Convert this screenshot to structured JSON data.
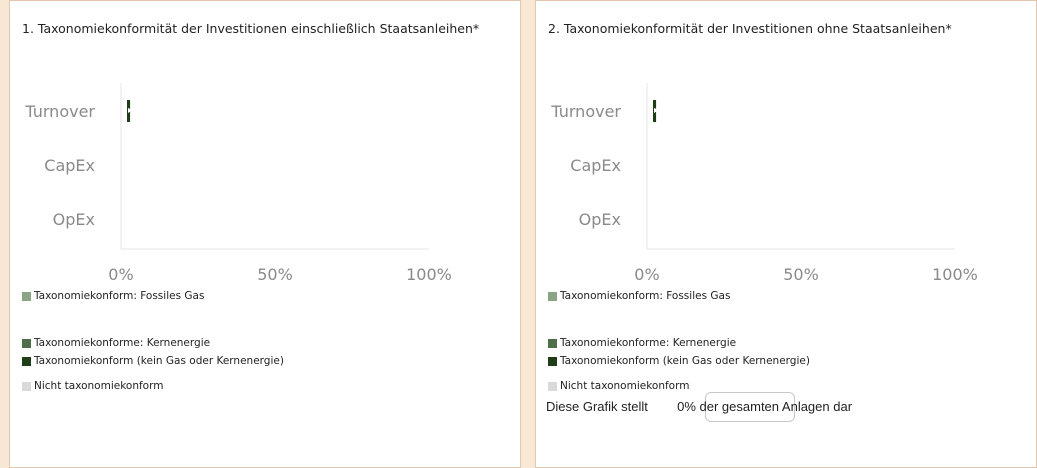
{
  "colors": {
    "fossil_gas": "#8aa585",
    "nuclear": "#4e6e4a",
    "aligned_other": "#1f3d17",
    "not_aligned": "#d9d9d9"
  },
  "panels": [
    {
      "title": "1. Taxonomiekonformität der Investitionen einschließlich Staatsanleihen*",
      "legend": [
        {
          "label": "Taxonomiekonform: Fossiles Gas",
          "color": "#8aa585"
        },
        {
          "label": "Taxonomiekonforme: Kernenergie",
          "color": "#4e6e4a"
        },
        {
          "label": "Taxonomiekonform (kein Gas oder Kernenergie)",
          "color": "#1f3d17"
        },
        {
          "label": "Nicht taxonomiekonform",
          "color": "#d9d9d9"
        }
      ]
    },
    {
      "title": "2. Taxonomiekonformität der Investitionen ohne Staatsanleihen*",
      "legend": [
        {
          "label": "Taxonomiekonform: Fossiles Gas",
          "color": "#8aa585"
        },
        {
          "label": "Taxonomiekonforme: Kernenergie",
          "color": "#4e6e4a"
        },
        {
          "label": "Taxonomiekonform (kein Gas oder Kernenergie)",
          "color": "#1f3d17"
        },
        {
          "label": "Nicht taxonomiekonform",
          "color": "#d9d9d9"
        }
      ],
      "footnote": {
        "prefix": "Diese Grafik stellt",
        "value": "0",
        "suffix": "% der gesamten Anlagen dar"
      }
    }
  ],
  "chart_data": [
    {
      "type": "bar",
      "orientation": "horizontal",
      "stacked": true,
      "title": "1. Taxonomiekonformität der Investitionen einschließlich Staatsanleihen*",
      "categories": [
        "Turnover",
        "CapEx",
        "OpEx"
      ],
      "x_ticks": [
        "0%",
        "50%",
        "100%"
      ],
      "xlim": [
        0,
        100
      ],
      "series": [
        {
          "name": "Taxonomiekonform: Fossiles Gas",
          "values": [
            0,
            0,
            0
          ]
        },
        {
          "name": "Taxonomiekonforme: Kernenergie",
          "values": [
            0,
            0,
            0
          ]
        },
        {
          "name": "Taxonomiekonform (kein Gas oder Kernenergie)",
          "values": [
            1,
            0,
            0
          ]
        },
        {
          "name": "Nicht taxonomiekonform",
          "values": [
            0,
            0,
            0
          ]
        }
      ]
    },
    {
      "type": "bar",
      "orientation": "horizontal",
      "stacked": true,
      "title": "2. Taxonomiekonformität der Investitionen ohne Staatsanleihen*",
      "categories": [
        "Turnover",
        "CapEx",
        "OpEx"
      ],
      "x_ticks": [
        "0%",
        "50%",
        "100%"
      ],
      "xlim": [
        0,
        100
      ],
      "series": [
        {
          "name": "Taxonomiekonform: Fossiles Gas",
          "values": [
            0,
            0,
            0
          ]
        },
        {
          "name": "Taxonomiekonforme: Kernenergie",
          "values": [
            0,
            0,
            0
          ]
        },
        {
          "name": "Taxonomiekonform (kein Gas oder Kernenergie)",
          "values": [
            1,
            0,
            0
          ]
        },
        {
          "name": "Nicht taxonomiekonform",
          "values": [
            0,
            0,
            0
          ]
        }
      ]
    }
  ]
}
